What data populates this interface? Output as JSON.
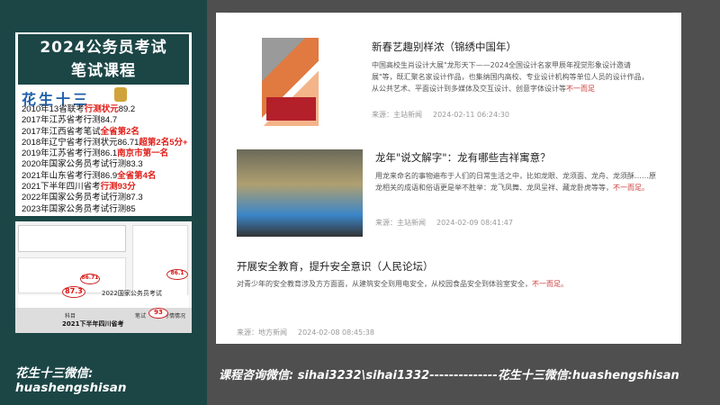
{
  "promo": {
    "title_line1": "2024公务员考试",
    "title_line2": "笔试课程",
    "name": "花生十三",
    "achievements": [
      {
        "text": "2010年13省联考",
        "hl": "行测状元",
        "tail": "89.2"
      },
      {
        "text": "2017年江苏省考行测84.7",
        "hl": "",
        "tail": ""
      },
      {
        "text": "2017年江西省考笔试",
        "hl": "全省第2名",
        "tail": ""
      },
      {
        "text": "2018年辽宁省考行测状元86.71",
        "hl": "超第2名5分+",
        "tail": ""
      },
      {
        "text": "2019年江苏省考行测86.1",
        "hl": "南京市第一名",
        "tail": ""
      },
      {
        "text": "2020年国家公务员考试行测83.3",
        "hl": "",
        "tail": ""
      },
      {
        "text": "2021年山东省考行测86.9",
        "hl": "全省第4名",
        "tail": ""
      },
      {
        "text": "2021下半年四川省考",
        "hl": "行测93分",
        "tail": ""
      },
      {
        "text": "2022年国家公务员考试行测87.3",
        "hl": "",
        "tail": ""
      },
      {
        "text": "2023年国家公务员考试行测85",
        "hl": "",
        "tail": ""
      }
    ],
    "scores": {
      "s1": "86.71",
      "s2": "86.1",
      "s3": "87.3",
      "s3_label": "2022国家公务员考试",
      "s4": "93",
      "s4_label": "2021下半年四川省考",
      "header_subject": "科目",
      "header_score": "笔试",
      "header_other": "考情情况"
    },
    "wechat_caption": "花生十三微信: huashengshisan"
  },
  "articles": [
    {
      "title": "新春艺趣别样浓（锦绣中国年）",
      "desc": "中国高校生肖设计大展\"龙形天下——2024全国设计名家甲辰年视觉形象设计邀请展\"等，既汇聚名家设计作品，也集纳国内高校、专业设计机构等单位人员的设计作品，从公共艺术、平面设计到多媒体及交互设计、创意字体设计等",
      "desc_hl": "不一而足",
      "source": "来源：主站新闻",
      "time": "2024-02-11 06:24:30"
    },
    {
      "title": "龙年\"说文解字\"：龙有哪些吉祥寓意？",
      "desc": "用龙来命名的事物遍布于人们的日常生活之中，比如龙眼、龙须面、龙舟、龙须酥……原龙相关的成语和俗语更是举不胜举：龙飞凤舞、龙凤呈祥、藏龙卧虎等等，",
      "desc_hl": "不一而足。",
      "source": "来源：主站新闻",
      "time": "2024-02-09 08:41:47"
    },
    {
      "title": "开展安全教育，提升安全意识（人民论坛）",
      "desc": "对青少年的安全教育涉及方方面面，从建筑安全到用电安全，从校园食品安全到体验室安全，",
      "desc_hl": "不一而足。",
      "source": "来源：地方新闻",
      "time": "2024-02-08 08:45:38"
    }
  ],
  "footer": "课程咨询微信: sihai3232\\sihai1332--------------花生十三微信:huashengshisan"
}
